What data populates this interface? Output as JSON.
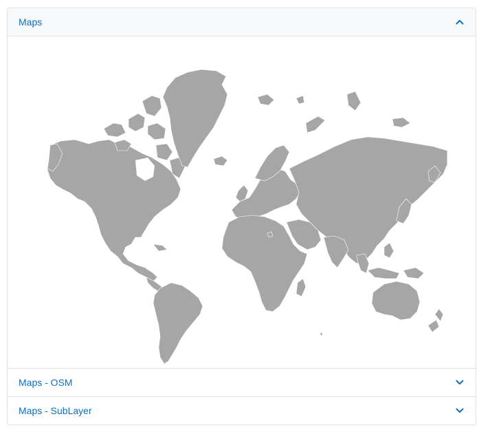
{
  "accordion": {
    "items": [
      {
        "label": "Maps",
        "expanded": true,
        "chevron": "chevron-up-icon"
      },
      {
        "label": "Maps - OSM",
        "expanded": false,
        "chevron": "chevron-down-icon"
      },
      {
        "label": "Maps - SubLayer",
        "expanded": false,
        "chevron": "chevron-down-icon"
      }
    ]
  },
  "colors": {
    "accent": "#0d6ebd",
    "land": "#a6a6a6",
    "border": "#dee2e6",
    "header_bg": "#f8f9fa"
  }
}
